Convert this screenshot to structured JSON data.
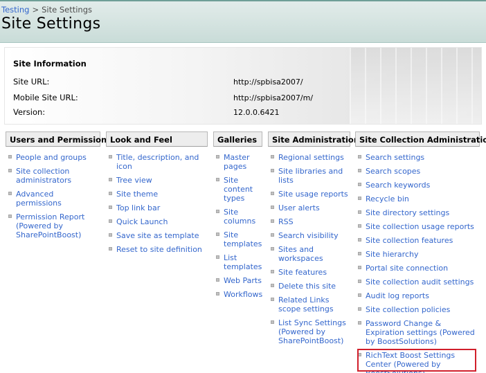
{
  "breadcrumb": {
    "parent": "Testing",
    "separator": ">",
    "current": "Site Settings"
  },
  "page_title": "Site Settings",
  "site_information": {
    "heading": "Site Information",
    "rows": [
      {
        "label": "Site URL:",
        "value": "http://spbisa2007/"
      },
      {
        "label": "Mobile Site URL:",
        "value": "http://spbisa2007/m/"
      },
      {
        "label": "Version:",
        "value": "12.0.0.6421"
      }
    ]
  },
  "columns": [
    {
      "title": "Users and Permissions",
      "items": [
        "People and groups",
        "Site collection administrators",
        "Advanced permissions",
        "Permission Report (Powered by SharePointBoost)"
      ]
    },
    {
      "title": "Look and Feel",
      "items": [
        "Title, description, and icon",
        "Tree view",
        "Site theme",
        "Top link bar",
        "Quick Launch",
        "Save site as template",
        "Reset to site definition"
      ]
    },
    {
      "title": "Galleries",
      "items": [
        "Master pages",
        "Site content types",
        "Site columns",
        "Site templates",
        "List templates",
        "Web Parts",
        "Workflows"
      ]
    },
    {
      "title": "Site Administration",
      "items": [
        "Regional settings",
        "Site libraries and lists",
        "Site usage reports",
        "User alerts",
        "RSS",
        "Search visibility",
        "Sites and workspaces",
        "Site features",
        "Delete this site",
        "Related Links scope settings",
        "List Sync Settings (Powered by SharePointBoost)"
      ]
    },
    {
      "title": "Site Collection Administration",
      "items": [
        "Search settings",
        "Search scopes",
        "Search keywords",
        "Recycle bin",
        "Site directory settings",
        "Site collection usage reports",
        "Site collection features",
        "Site hierarchy",
        "Portal site connection",
        "Site collection audit settings",
        "Audit log reports",
        "Site collection policies",
        "Password Change & Expiration settings (Powered by BoostSolutions)",
        "RichText Boost Settings Center (Powered by BoostSolutions)"
      ]
    }
  ],
  "colors": {
    "link": "#3366cc",
    "header_bg": "#c9dcd8",
    "highlight": "#d11f2b"
  }
}
